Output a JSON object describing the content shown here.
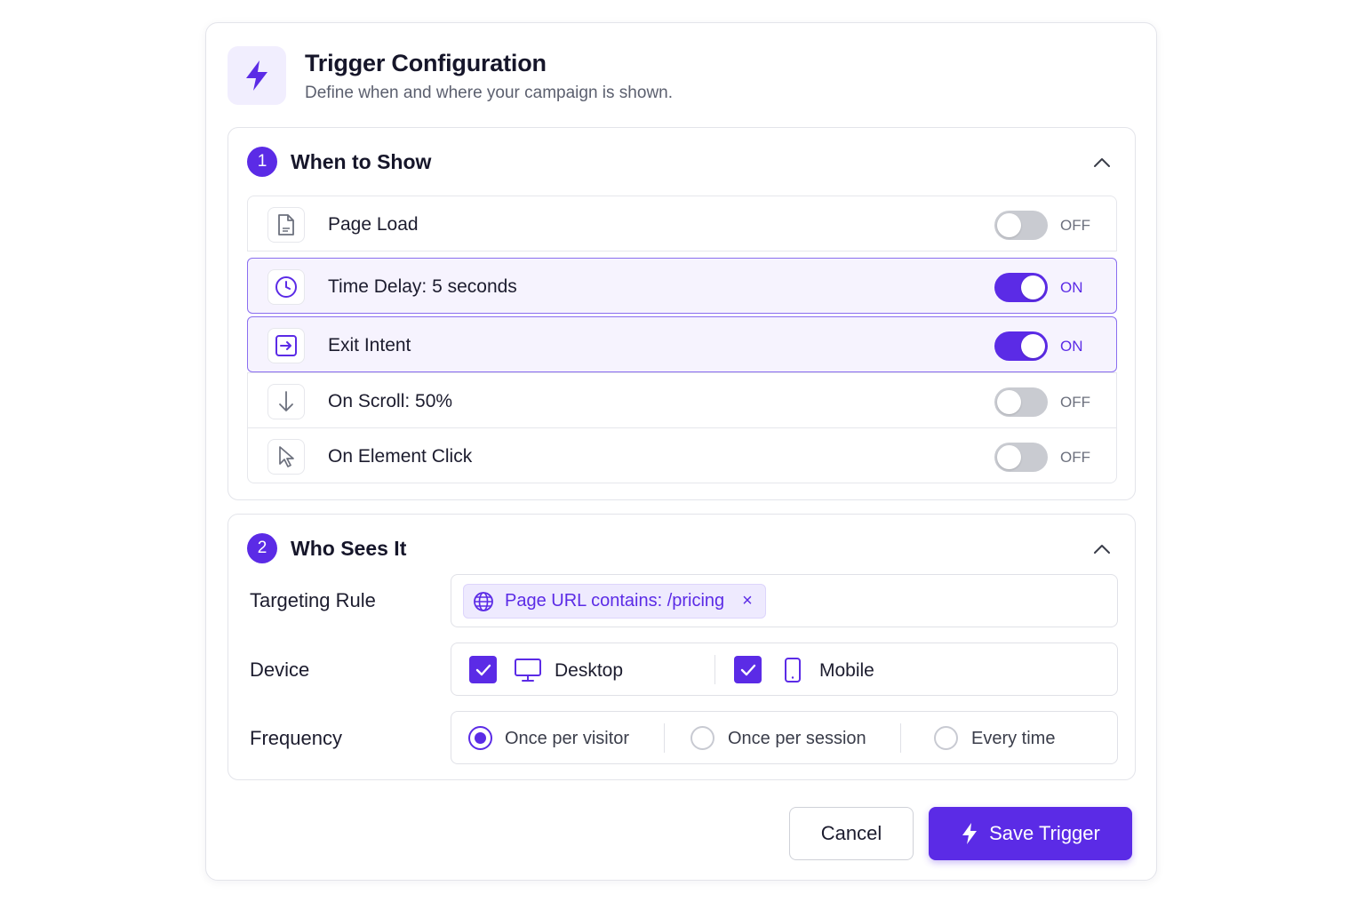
{
  "header": {
    "title": "Trigger Configuration",
    "subtitle": "Define when and where your campaign is shown.",
    "icon": "lightning-icon"
  },
  "colors": {
    "accent": "#5b2be6",
    "toggle_off": "#c9cbd1",
    "active_row_bg": "#f6f3fe"
  },
  "when_section": {
    "number": "1",
    "title": "When to Show",
    "triggers": [
      {
        "label": "Page Load",
        "icon": "file-icon",
        "enabled": false,
        "state": "OFF"
      },
      {
        "label": "Time Delay: 5 seconds",
        "icon": "clock-icon",
        "enabled": true,
        "state": "ON"
      },
      {
        "label": "Exit Intent",
        "icon": "exit-icon",
        "enabled": true,
        "state": "ON"
      },
      {
        "label": "On Scroll: 50%",
        "icon": "arrow-down-icon",
        "enabled": false,
        "state": "OFF"
      },
      {
        "label": "On Element Click",
        "icon": "cursor-icon",
        "enabled": false,
        "state": "OFF"
      }
    ]
  },
  "who_section": {
    "number": "2",
    "title": "Who Sees It",
    "targeting": {
      "label": "Targeting Rule",
      "chip": "Page URL contains: /pricing",
      "remove": "×"
    },
    "device": {
      "label": "Device",
      "options": [
        {
          "label": "Desktop",
          "checked": true,
          "icon": "desktop-icon"
        },
        {
          "label": "Mobile",
          "checked": true,
          "icon": "mobile-icon"
        }
      ]
    },
    "frequency": {
      "label": "Frequency",
      "options": [
        {
          "label": "Once per visitor",
          "selected": true
        },
        {
          "label": "Once per session",
          "selected": false
        },
        {
          "label": "Every time",
          "selected": false
        }
      ]
    }
  },
  "actions": {
    "cancel": "Cancel",
    "save": "Save Trigger"
  }
}
